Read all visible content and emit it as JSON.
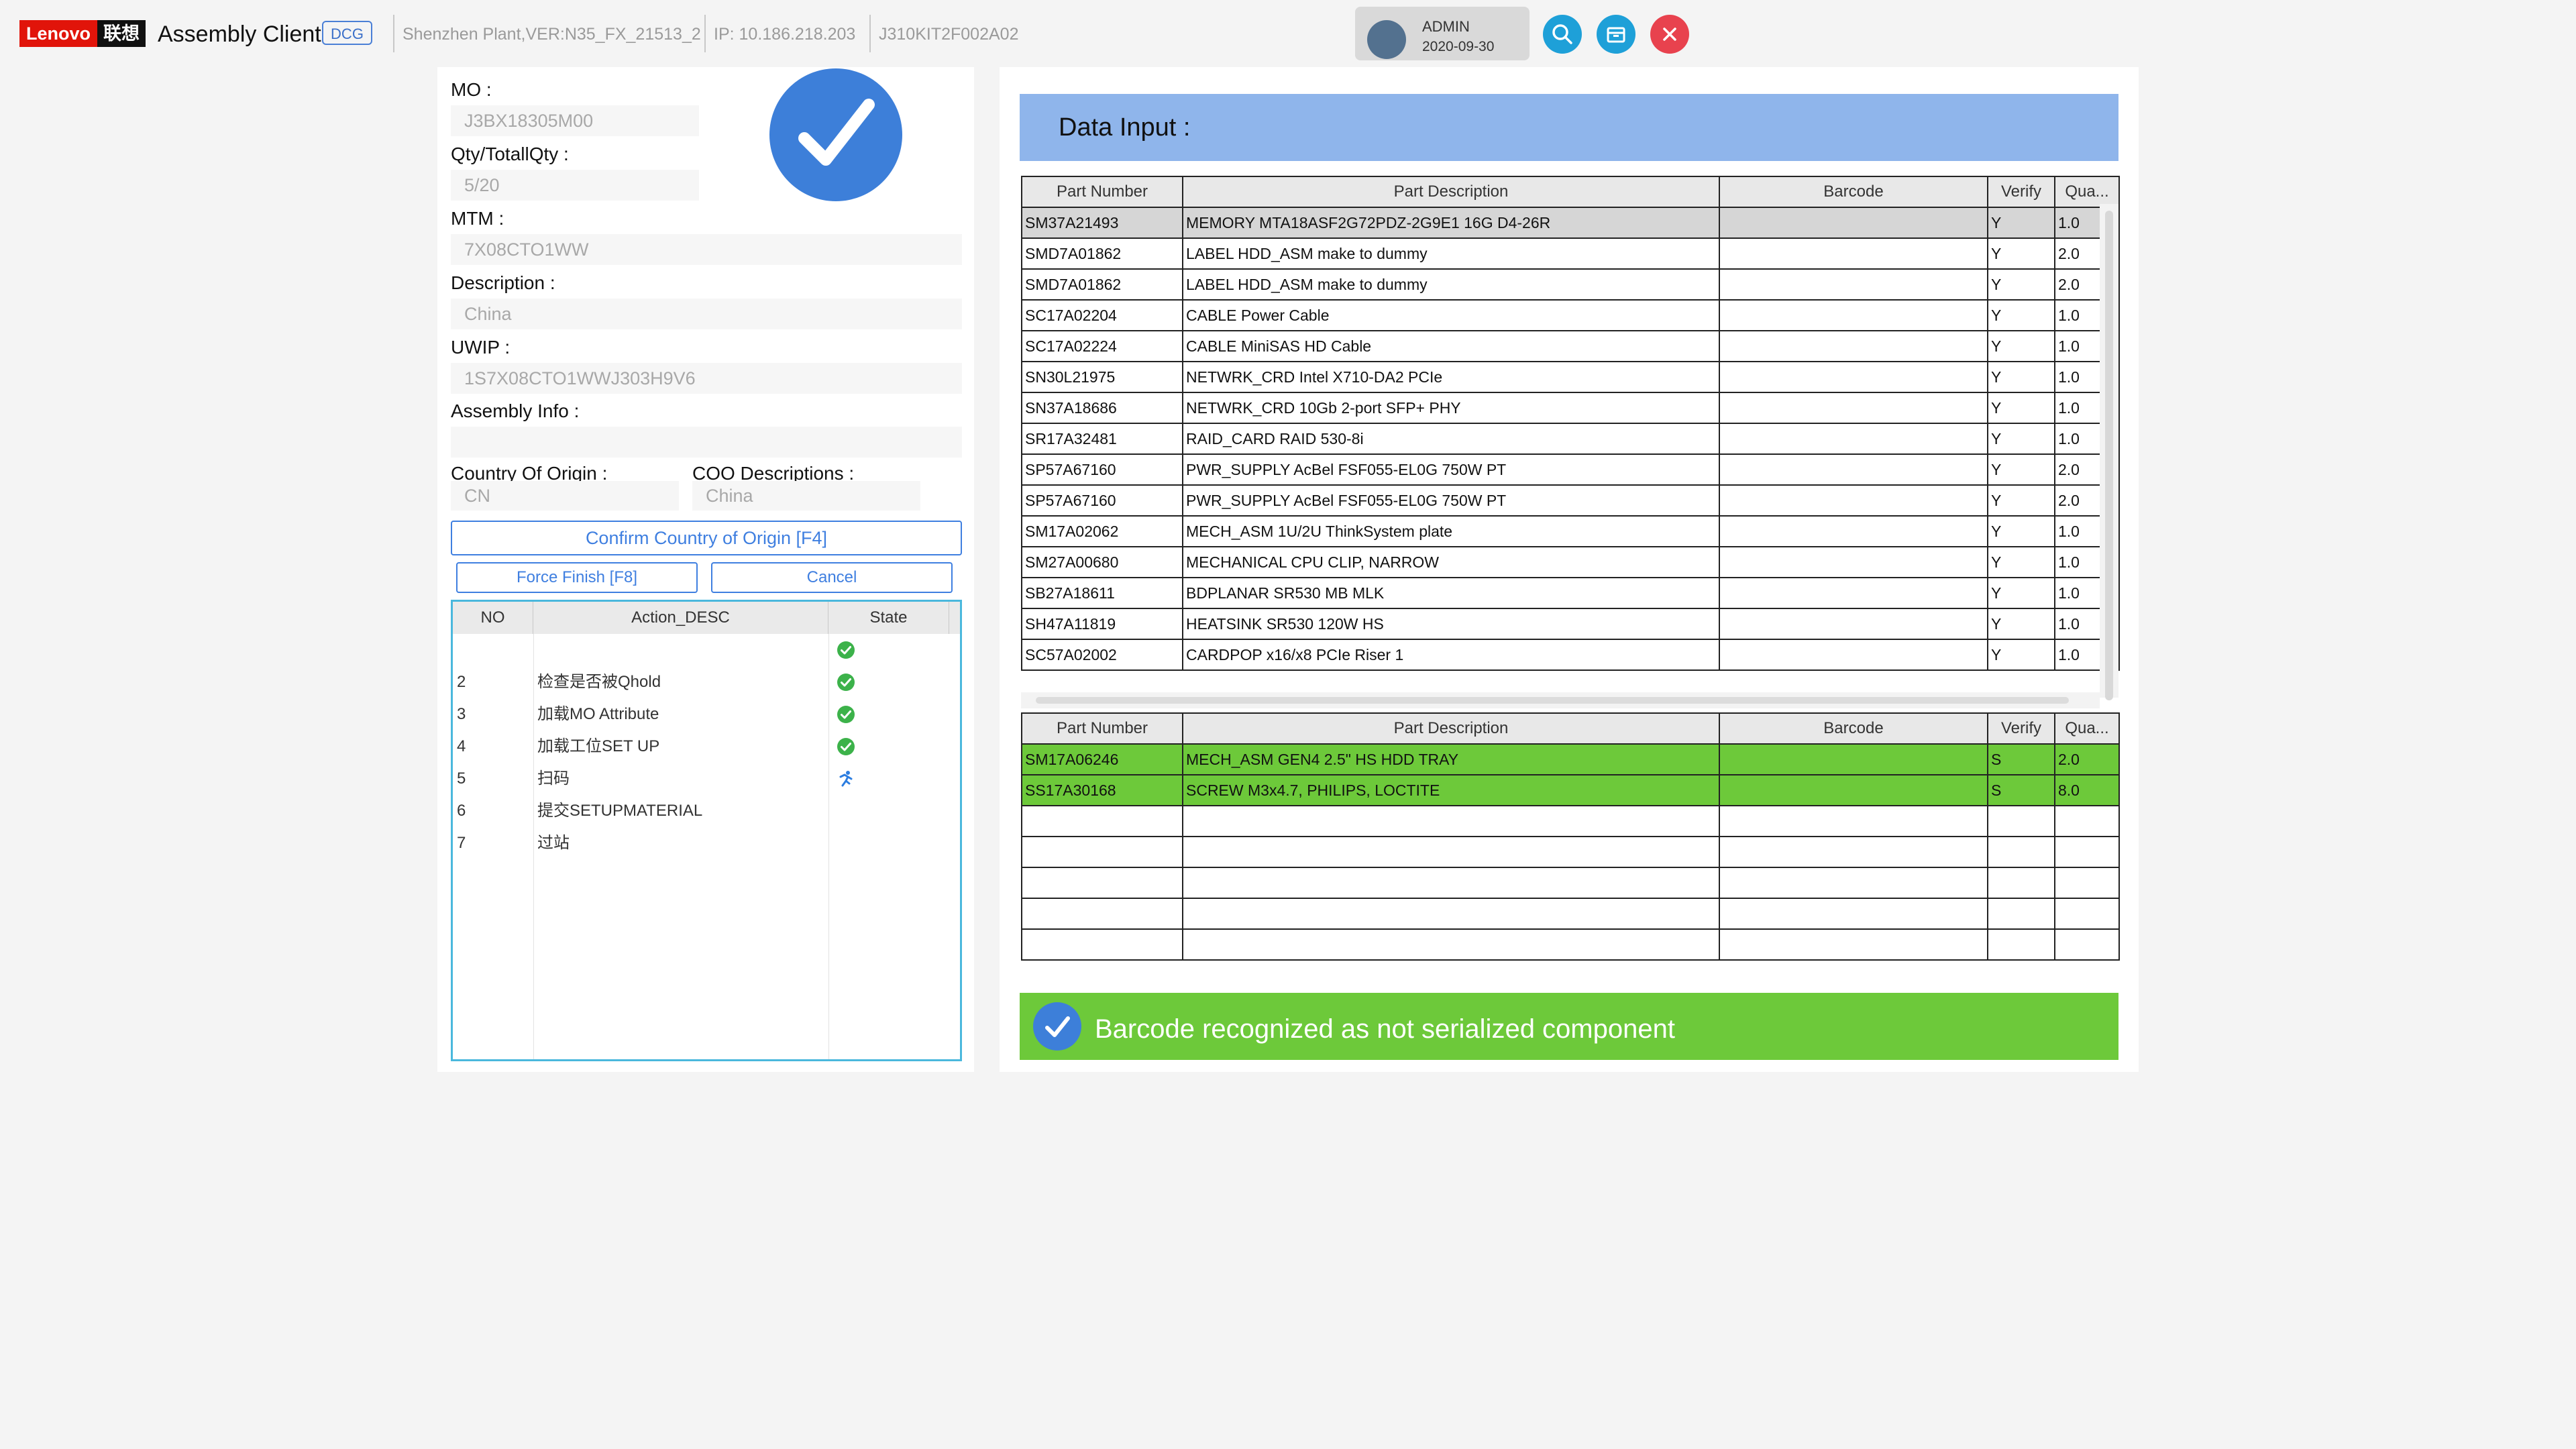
{
  "header": {
    "logo_text": "Lenovo",
    "logo_cn": "联想",
    "app_title": "Assembly Client",
    "badge": "DCG",
    "plant_info": "Shenzhen Plant,VER:N35_FX_21513_2",
    "ip": "IP: 10.186.218.203",
    "station": "J310KIT2F002A02",
    "user": {
      "name": "ADMIN",
      "date": "2020-09-30"
    },
    "buttons": {
      "search": "search-icon",
      "package": "package-icon",
      "close": "close-icon"
    },
    "colors": {
      "lenovo_red": "#e1140a",
      "accent_blue": "#3d7fd9",
      "icon_cyan": "#1ea0d8",
      "close_red": "#e8424e"
    }
  },
  "left": {
    "mo": {
      "label": "MO :",
      "value": "J3BX18305M00"
    },
    "qty": {
      "label": "Qty/TotallQty :",
      "value": "5/20"
    },
    "mtm": {
      "label": "MTM :",
      "value": "7X08CTO1WW"
    },
    "description": {
      "label": "Description :",
      "value": "China"
    },
    "uwip": {
      "label": "UWIP :",
      "value": "1S7X08CTO1WWJ303H9V6"
    },
    "assembly_info": {
      "label": "Assembly Info :",
      "value": ""
    },
    "coo": {
      "label": "Country Of Origin :",
      "value": "CN"
    },
    "coo_desc": {
      "label": "COO Descriptions :",
      "value": "China"
    },
    "buttons": {
      "confirm": "Confirm Country of Origin [F4]",
      "force_finish": "Force Finish [F8]",
      "cancel": "Cancel"
    },
    "actions": {
      "headers": {
        "no": "NO",
        "desc": "Action_DESC",
        "state": "State"
      },
      "rows": [
        {
          "no": "",
          "desc": "",
          "state": "done"
        },
        {
          "no": "2",
          "desc": "检查是否被Qhold",
          "state": "done"
        },
        {
          "no": "3",
          "desc": "加载MO Attribute",
          "state": "done"
        },
        {
          "no": "4",
          "desc": "加载工位SET UP",
          "state": "done"
        },
        {
          "no": "5",
          "desc": "扫码",
          "state": "running"
        },
        {
          "no": "6",
          "desc": "提交SETUPMATERIAL",
          "state": ""
        },
        {
          "no": "7",
          "desc": "过站",
          "state": ""
        }
      ]
    }
  },
  "right": {
    "title": "Data Input :",
    "columns": [
      "Part Number",
      "Part Description",
      "Barcode",
      "Verify",
      "Qua..."
    ],
    "table1": [
      {
        "pn": "SM37A21493",
        "desc": "MEMORY MTA18ASF2G72PDZ-2G9E1 16G D4-26R",
        "barcode": "",
        "verify": "Y",
        "qty": "1.0",
        "status": "selected"
      },
      {
        "pn": "SMD7A01862",
        "desc": "LABEL HDD_ASM make to dummy",
        "barcode": "",
        "verify": "Y",
        "qty": "2.0",
        "status": ""
      },
      {
        "pn": "SMD7A01862",
        "desc": "LABEL HDD_ASM make to dummy",
        "barcode": "",
        "verify": "Y",
        "qty": "2.0",
        "status": ""
      },
      {
        "pn": "SC17A02204",
        "desc": "CABLE Power Cable",
        "barcode": "",
        "verify": "Y",
        "qty": "1.0",
        "status": ""
      },
      {
        "pn": "SC17A02224",
        "desc": "CABLE MiniSAS HD Cable",
        "barcode": "",
        "verify": "Y",
        "qty": "1.0",
        "status": ""
      },
      {
        "pn": "SN30L21975",
        "desc": "NETWRK_CRD Intel X710-DA2 PCIe",
        "barcode": "",
        "verify": "Y",
        "qty": "1.0",
        "status": ""
      },
      {
        "pn": "SN37A18686",
        "desc": "NETWRK_CRD 10Gb 2-port SFP+ PHY",
        "barcode": "",
        "verify": "Y",
        "qty": "1.0",
        "status": ""
      },
      {
        "pn": "SR17A32481",
        "desc": "RAID_CARD RAID 530-8i",
        "barcode": "",
        "verify": "Y",
        "qty": "1.0",
        "status": ""
      },
      {
        "pn": "SP57A67160",
        "desc": "PWR_SUPPLY AcBel FSF055-EL0G 750W PT",
        "barcode": "",
        "verify": "Y",
        "qty": "2.0",
        "status": ""
      },
      {
        "pn": "SP57A67160",
        "desc": "PWR_SUPPLY AcBel FSF055-EL0G 750W PT",
        "barcode": "",
        "verify": "Y",
        "qty": "2.0",
        "status": ""
      },
      {
        "pn": "SM17A02062",
        "desc": "MECH_ASM 1U/2U ThinkSystem plate",
        "barcode": "",
        "verify": "Y",
        "qty": "1.0",
        "status": ""
      },
      {
        "pn": "SM27A00680",
        "desc": "MECHANICAL CPU CLIP, NARROW",
        "barcode": "",
        "verify": "Y",
        "qty": "1.0",
        "status": ""
      },
      {
        "pn": "SB27A18611",
        "desc": "BDPLANAR SR530 MB MLK",
        "barcode": "",
        "verify": "Y",
        "qty": "1.0",
        "status": ""
      },
      {
        "pn": "SH47A11819",
        "desc": "HEATSINK SR530 120W HS",
        "barcode": "",
        "verify": "Y",
        "qty": "1.0",
        "status": ""
      },
      {
        "pn": "SC57A02002",
        "desc": "CARDPOP x16/x8 PCIe Riser 1",
        "barcode": "",
        "verify": "Y",
        "qty": "1.0",
        "status": ""
      }
    ],
    "table2": [
      {
        "pn": "SM17A06246",
        "desc": "MECH_ASM GEN4 2.5\" HS HDD TRAY",
        "barcode": "",
        "verify": "S",
        "qty": "2.0",
        "status": "ok"
      },
      {
        "pn": "SS17A30168",
        "desc": "SCREW M3x4.7, PHILIPS, LOCTITE",
        "barcode": "",
        "verify": "S",
        "qty": "8.0",
        "status": "ok"
      },
      {
        "pn": "",
        "desc": "",
        "barcode": "",
        "verify": "",
        "qty": "",
        "status": ""
      },
      {
        "pn": "",
        "desc": "",
        "barcode": "",
        "verify": "",
        "qty": "",
        "status": ""
      },
      {
        "pn": "",
        "desc": "",
        "barcode": "",
        "verify": "",
        "qty": "",
        "status": ""
      },
      {
        "pn": "",
        "desc": "",
        "barcode": "",
        "verify": "",
        "qty": "",
        "status": ""
      },
      {
        "pn": "",
        "desc": "",
        "barcode": "",
        "verify": "",
        "qty": "",
        "status": ""
      }
    ],
    "status": {
      "icon": "check-circle-icon",
      "text": "Barcode recognized as not serialized component",
      "color": "#6dc93a"
    }
  }
}
